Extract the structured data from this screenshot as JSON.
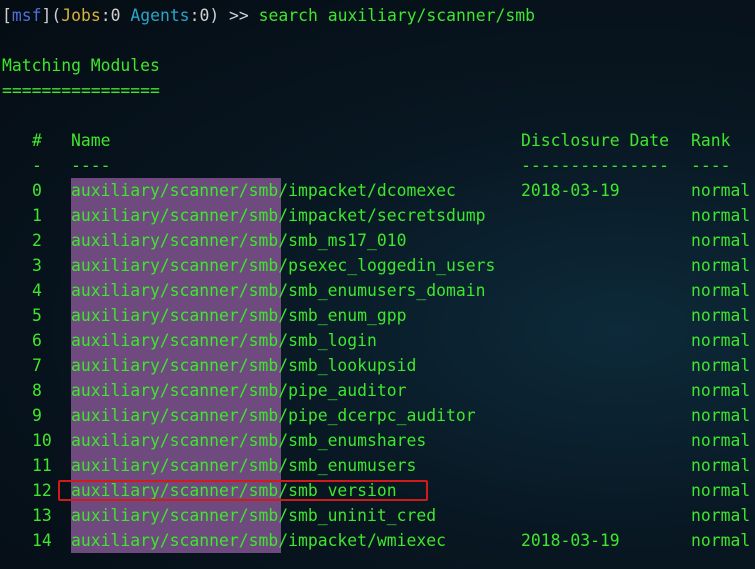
{
  "prompt": {
    "open_bracket": "[",
    "msf": "msf",
    "close_bracket": "]",
    "open_paren": "(",
    "jobs_label": "Jobs",
    "jobs_colon": ":",
    "jobs_value": "0",
    "space": " ",
    "agents_label": "Agents",
    "agents_colon": ":",
    "agents_value": "0",
    "close_paren": ")",
    "arrow": " >> ",
    "command": "search auxiliary/scanner/smb"
  },
  "output": {
    "heading": "Matching Modules",
    "heading_underline": "================",
    "headers": {
      "num": "#",
      "name": "Name",
      "date": "Disclosure Date",
      "rank": "Rank"
    },
    "separators": {
      "num": "-",
      "name": "----",
      "date": "---------------",
      "rank": "----"
    },
    "highlight_color": "#6e4a7e",
    "selection_color": "#d11a1a",
    "selected_index": 12,
    "rows": [
      {
        "num": "0",
        "name": "auxiliary/scanner/smb/impacket/dcomexec",
        "date": "2018-03-19",
        "rank": "normal"
      },
      {
        "num": "1",
        "name": "auxiliary/scanner/smb/impacket/secretsdump",
        "date": "",
        "rank": "normal"
      },
      {
        "num": "2",
        "name": "auxiliary/scanner/smb/smb_ms17_010",
        "date": "",
        "rank": "normal"
      },
      {
        "num": "3",
        "name": "auxiliary/scanner/smb/psexec_loggedin_users",
        "date": "",
        "rank": "normal"
      },
      {
        "num": "4",
        "name": "auxiliary/scanner/smb/smb_enumusers_domain",
        "date": "",
        "rank": "normal"
      },
      {
        "num": "5",
        "name": "auxiliary/scanner/smb/smb_enum_gpp",
        "date": "",
        "rank": "normal"
      },
      {
        "num": "6",
        "name": "auxiliary/scanner/smb/smb_login",
        "date": "",
        "rank": "normal"
      },
      {
        "num": "7",
        "name": "auxiliary/scanner/smb/smb_lookupsid",
        "date": "",
        "rank": "normal"
      },
      {
        "num": "8",
        "name": "auxiliary/scanner/smb/pipe_auditor",
        "date": "",
        "rank": "normal"
      },
      {
        "num": "9",
        "name": "auxiliary/scanner/smb/pipe_dcerpc_auditor",
        "date": "",
        "rank": "normal"
      },
      {
        "num": "10",
        "name": "auxiliary/scanner/smb/smb_enumshares",
        "date": "",
        "rank": "normal"
      },
      {
        "num": "11",
        "name": "auxiliary/scanner/smb/smb_enumusers",
        "date": "",
        "rank": "normal"
      },
      {
        "num": "12",
        "name": "auxiliary/scanner/smb/smb_version",
        "date": "",
        "rank": "normal"
      },
      {
        "num": "13",
        "name": "auxiliary/scanner/smb/smb_uninit_cred",
        "date": "",
        "rank": "normal"
      },
      {
        "num": "14",
        "name": "auxiliary/scanner/smb/impacket/wmiexec",
        "date": "2018-03-19",
        "rank": "normal"
      }
    ]
  }
}
